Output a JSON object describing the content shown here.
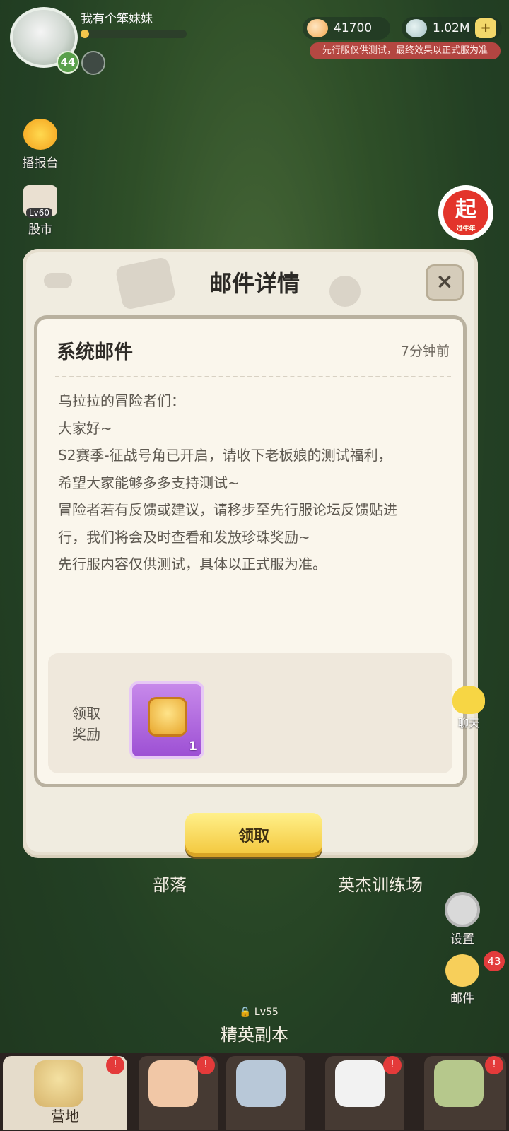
{
  "player": {
    "name": "我有个笨妹妹",
    "level": "44",
    "xp_fraction": 0.08
  },
  "resources": [
    {
      "icon": "coin-icon",
      "value": "41700"
    },
    {
      "icon": "pearl-icon",
      "value": "1.02M"
    }
  ],
  "notice": "先行服仅供测试，最终效果以正式服为准",
  "side": {
    "broadcast": "播报台",
    "stock": "股市",
    "stock_lock": "Lv60",
    "qi_badge": "起",
    "qi_sub": "过牛年",
    "chat": "聊天",
    "settings": "设置",
    "mail": "邮件",
    "mail_count": "43"
  },
  "modal": {
    "title": "邮件详情",
    "close": "×",
    "mail_title": "系统邮件",
    "mail_time": "7分钟前",
    "body": [
      "乌拉拉的冒险者们：",
      "大家好~",
      "S2赛季-征战号角已开启，请收下老板娘的测试福利，",
      "希望大家能够多多支持测试~",
      "冒险者若有反馈或建议，请移步至先行服论坛反馈贴进",
      "行，我们将会及时查看和发放珍珠奖励~",
      "先行服内容仅供测试，具体以正式服为准。"
    ],
    "reward_label": "领取\n奖励",
    "reward_count": "1",
    "claim": "领取"
  },
  "map_labels": {
    "tribe": "部落",
    "hero_training": "英杰训练场",
    "elite_lock": "Lv55",
    "elite_dungeon": "精英副本"
  },
  "nav": {
    "camp": "营地"
  },
  "colors": {
    "accent": "#f3c63a",
    "badge_red": "#e23c3c",
    "modal_bg": "#f0ece0"
  }
}
